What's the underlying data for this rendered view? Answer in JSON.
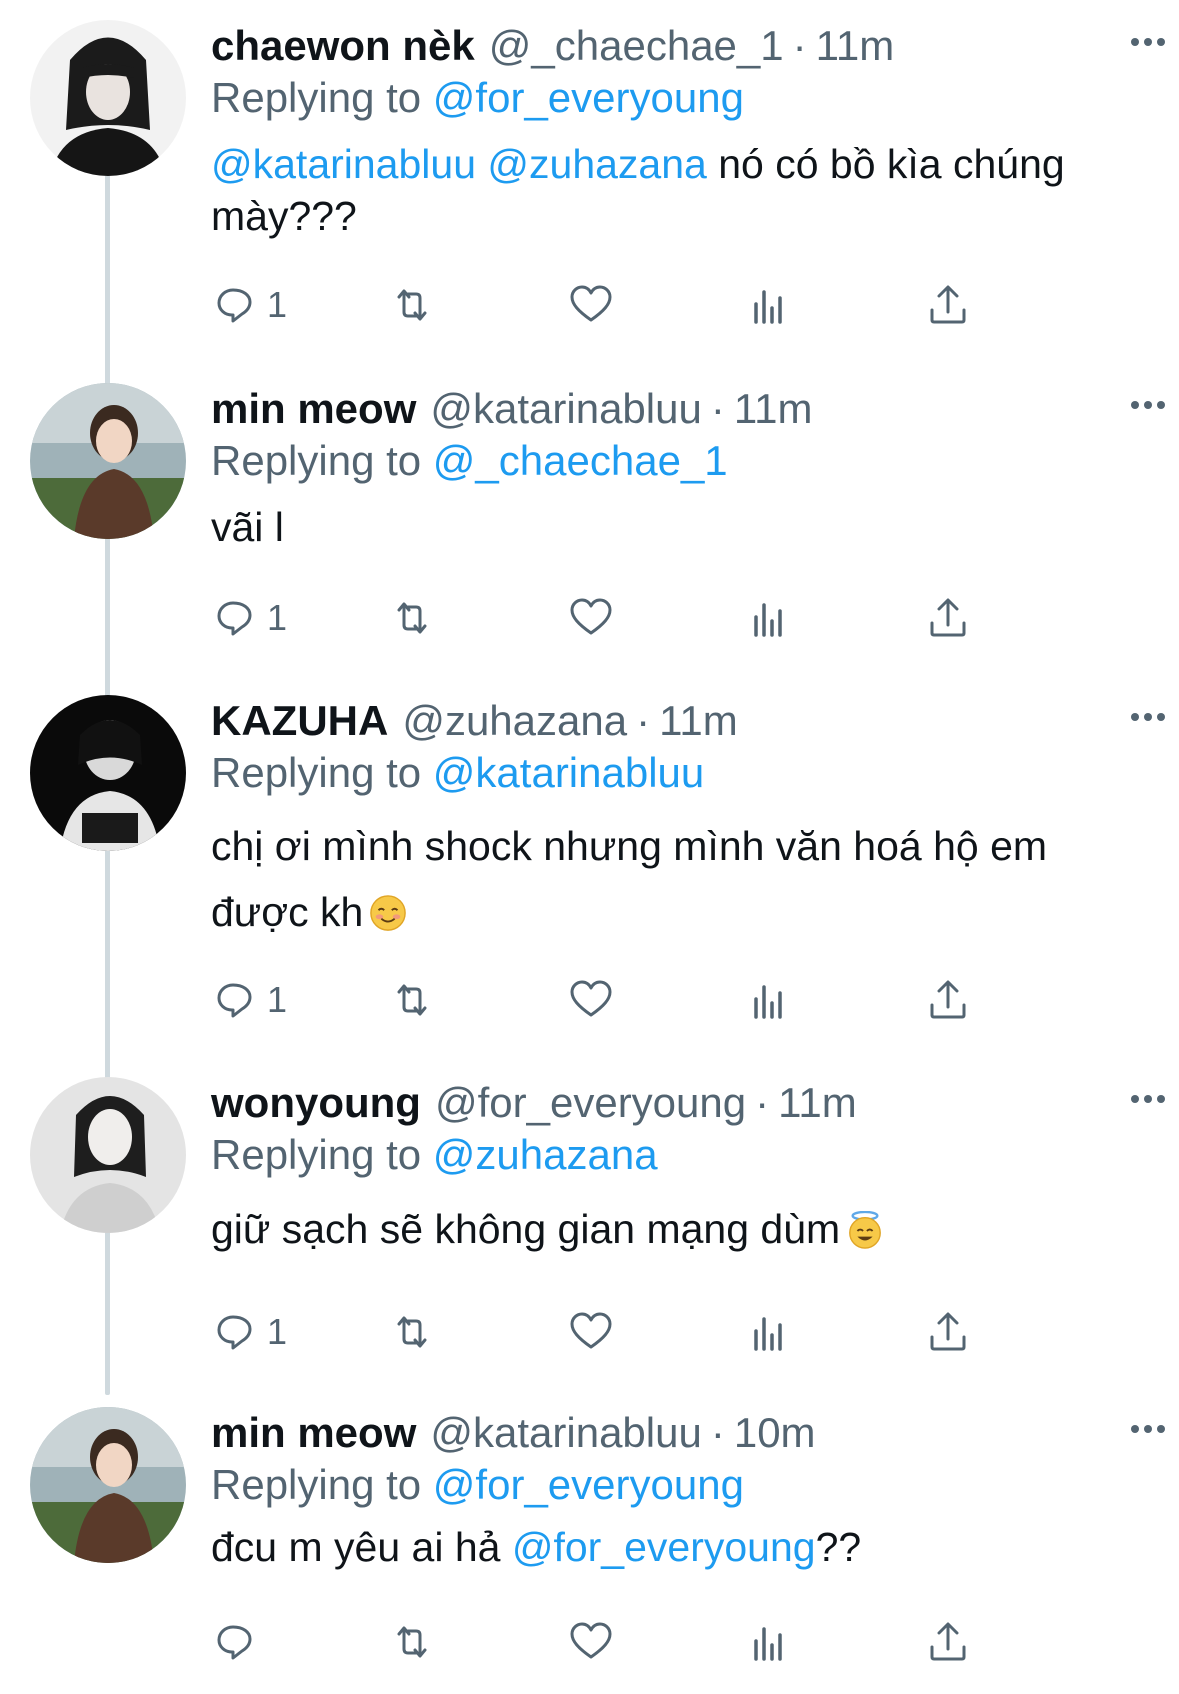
{
  "tweets": [
    {
      "name": "chaewon nèk",
      "handle": "@_chaechae_1",
      "time": "11m",
      "replying_label": "Replying to",
      "replying_to": "@for_everyoung",
      "text_parts": [
        {
          "text": "@katarinabluu",
          "mention": true
        },
        {
          "text": " ",
          "mention": false
        },
        {
          "text": "@zuhazana",
          "mention": true
        },
        {
          "text": " nó có bồ kìa chúng mày???",
          "mention": false
        }
      ],
      "reply_count": "1",
      "avatar_icon": "avatar-photo-icon"
    },
    {
      "name": "min meow",
      "handle": "@katarinabluu",
      "time": "11m",
      "replying_label": "Replying to",
      "replying_to": "@_chaechae_1",
      "text_parts": [
        {
          "text": "vãi l",
          "mention": false
        }
      ],
      "reply_count": "1",
      "avatar_icon": "avatar-photo-icon"
    },
    {
      "name": "KAZUHA",
      "handle": "@zuhazana",
      "time": "11m",
      "replying_label": "Replying to",
      "replying_to": "@katarinabluu",
      "text_parts": [
        {
          "text": "chị ơi mình shock nhưng mình văn hoá hộ em được kh",
          "mention": false
        }
      ],
      "emoji": "smiling-face-emoji",
      "reply_count": "1",
      "avatar_icon": "avatar-photo-icon"
    },
    {
      "name": "wonyoung",
      "handle": "@for_everyoung",
      "time": "11m",
      "replying_label": "Replying to",
      "replying_to": "@zuhazana",
      "text_parts": [
        {
          "text": "giữ sạch sẽ không gian mạng dùm",
          "mention": false
        }
      ],
      "emoji": "halo-face-emoji",
      "reply_count": "1",
      "avatar_icon": "avatar-photo-icon"
    },
    {
      "name": "min meow",
      "handle": "@katarinabluu",
      "time": "10m",
      "replying_label": "Replying to",
      "replying_to": "@for_everyoung",
      "text_parts": [
        {
          "text": "đcu m yêu ai hả ",
          "mention": false
        },
        {
          "text": "@for_everyoung",
          "mention": true
        },
        {
          "text": "??",
          "mention": false
        }
      ],
      "reply_count": "",
      "avatar_icon": "avatar-photo-icon"
    }
  ],
  "separator": "·",
  "action_icons": [
    "reply-icon",
    "retweet-icon",
    "like-icon",
    "views-icon",
    "share-icon"
  ],
  "colors": {
    "text": "#0f1419",
    "secondary": "#536471",
    "link": "#1d9bf0",
    "thread_line": "#cfd9de"
  }
}
